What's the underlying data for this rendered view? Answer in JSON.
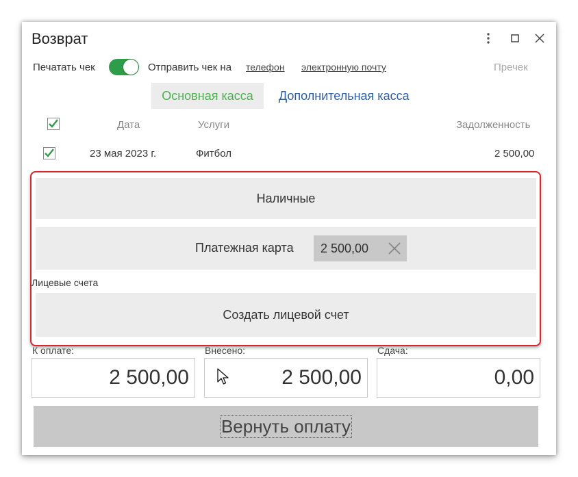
{
  "window": {
    "title": "Возврат"
  },
  "options": {
    "print_check_label": "Печатать чек",
    "print_check_on": true,
    "send_check_label": "Отправить чек на",
    "phone_link": "телефон",
    "email_link": "электронную почту",
    "recheck_label": "Пречек"
  },
  "tabs": {
    "main": "Основная касса",
    "extra": "Дополнительная касса"
  },
  "table": {
    "headers": {
      "date": "Дата",
      "service": "Услуги",
      "debt": "Задолженность"
    },
    "rows": [
      {
        "checked": true,
        "date": "23 мая 2023 г.",
        "service": "Фитбол",
        "debt": "2 500,00"
      }
    ]
  },
  "payment": {
    "cash_label": "Наличные",
    "card_label": "Платежная карта",
    "card_amount": "2 500,00",
    "accounts_label": "Лицевые счета",
    "create_account_label": "Создать лицевой счет"
  },
  "summary": {
    "to_pay_label": "К оплате:",
    "to_pay_value": "2 500,00",
    "paid_label": "Внесено:",
    "paid_value": "2 500,00",
    "change_label": "Сдача:",
    "change_value": "0,00"
  },
  "actions": {
    "return_label": "Вернуть оплату"
  },
  "colors": {
    "accent_green": "#4caf50",
    "toggle_green": "#2e9d4a",
    "link_blue": "#2b5ea8",
    "highlight_red": "#d9252f"
  }
}
